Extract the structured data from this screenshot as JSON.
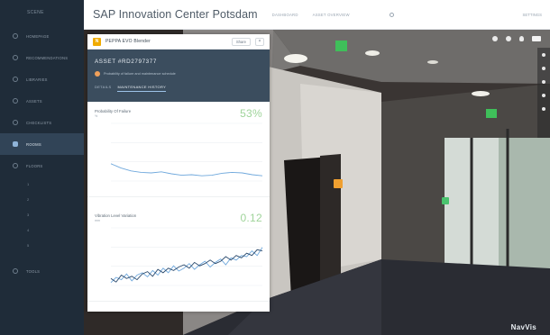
{
  "sidebar": {
    "brand": "SCENE",
    "items": [
      {
        "label": "HOMEPAGE",
        "active": false
      },
      {
        "label": "RECOMMENDATIONS",
        "active": false
      },
      {
        "label": "LIBRARIES",
        "active": false
      },
      {
        "label": "ASSETS",
        "active": false
      },
      {
        "label": "CHECKLISTS",
        "active": false
      },
      {
        "label": "ROOMS",
        "active": true
      },
      {
        "label": "FLOORS",
        "active": false
      }
    ],
    "subitems": [
      "1",
      "2",
      "3",
      "4",
      "5"
    ],
    "footer": "TOOLS"
  },
  "topbar": {
    "title": "SAP Innovation Center Potsdam",
    "tabs": [
      "DASHBOARD",
      "ASSET OVERVIEW"
    ],
    "right": "SETTINGS"
  },
  "card": {
    "logo": "N",
    "name": "PEPPA EVO Blender",
    "share_label": "Share",
    "close_label": "×",
    "asset_id": "ASSET #RD2797377",
    "alert_text": "Probability of failure and maintenance schedule",
    "tabs": [
      {
        "label": "DETAILS",
        "active": false
      },
      {
        "label": "MAINTENANCE HISTORY",
        "active": true
      }
    ],
    "metrics": [
      {
        "title": "Probability Of Failure",
        "unit": "%",
        "value": "53%"
      },
      {
        "title": "Vibration Level Variation",
        "unit": "mm",
        "value": "0.12"
      }
    ]
  },
  "viewer": {
    "watermark": "NavVis"
  },
  "colors": {
    "sidebar_bg": "#1f2c39",
    "card_header_bg": "#3b4d5e",
    "metric_green": "#9fd49a",
    "line_blue": "#6fa8dc",
    "line_navy": "#2c4b6e"
  },
  "chart_data": [
    {
      "type": "line",
      "title": "Probability Of Failure",
      "x": [
        0,
        1,
        2,
        3,
        4,
        5,
        6,
        7,
        8,
        9,
        10,
        11,
        12,
        13,
        14,
        15
      ],
      "series": [
        {
          "values": [
            0.6,
            0.45,
            0.35,
            0.3,
            0.28,
            0.32,
            0.25,
            0.2,
            0.22,
            0.18,
            0.2,
            0.27,
            0.3,
            0.28,
            0.22,
            0.18
          ]
        }
      ],
      "ylim": [
        0,
        2
      ]
    },
    {
      "type": "line",
      "title": "Vibration Level Variation",
      "x": [
        0,
        1,
        2,
        3,
        4,
        5,
        6,
        7,
        8,
        9,
        10,
        11,
        12,
        13,
        14,
        15,
        16,
        17,
        18,
        19,
        20,
        21,
        22,
        23,
        24,
        25,
        26,
        27,
        28,
        29
      ],
      "series": [
        {
          "values": [
            0.05,
            0.14,
            0.1,
            0.2,
            0.08,
            0.18,
            0.22,
            0.15,
            0.26,
            0.18,
            0.3,
            0.22,
            0.34,
            0.25,
            0.3,
            0.38,
            0.28,
            0.36,
            0.42,
            0.32,
            0.4,
            0.46,
            0.36,
            0.48,
            0.44,
            0.52,
            0.5,
            0.6,
            0.52,
            0.66
          ]
        },
        {
          "values": [
            0.12,
            0.06,
            0.18,
            0.12,
            0.16,
            0.1,
            0.2,
            0.24,
            0.16,
            0.28,
            0.22,
            0.3,
            0.26,
            0.32,
            0.36,
            0.3,
            0.4,
            0.34,
            0.38,
            0.44,
            0.38,
            0.42,
            0.5,
            0.44,
            0.52,
            0.48,
            0.56,
            0.52,
            0.62,
            0.6
          ]
        }
      ],
      "ylim": [
        0,
        1
      ]
    }
  ]
}
